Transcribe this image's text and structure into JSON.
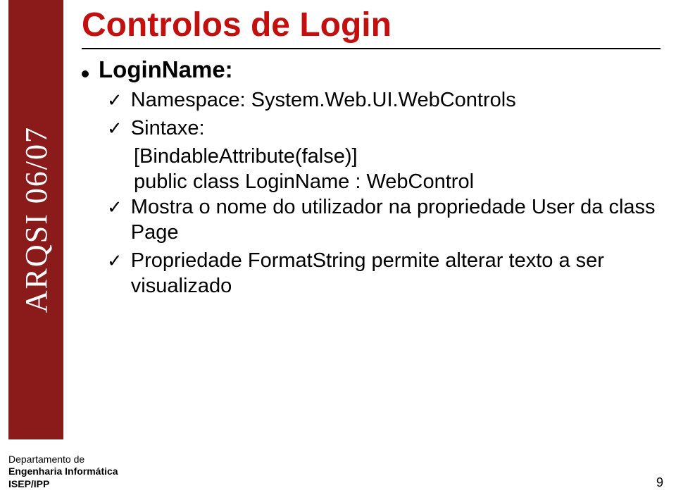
{
  "sidebar": {
    "label": "ARQSI 06/07"
  },
  "slide": {
    "title": "Controlos de Login"
  },
  "content": {
    "section": {
      "heading": "LoginName:",
      "items": [
        {
          "text": "Namespace: System.Web.UI.WebControls"
        },
        {
          "text": "Sintaxe:",
          "extra1": "[BindableAttribute(false)]",
          "extra2": "public class LoginName : WebControl"
        },
        {
          "text": "Mostra o nome do utilizador na propriedade User da class Page"
        },
        {
          "text": "Propriedade FormatString permite alterar texto a ser visualizado"
        }
      ]
    }
  },
  "footer": {
    "line1": "Departamento de",
    "line2": "Engenharia Informática",
    "line3": "ISEP/IPP"
  },
  "page": {
    "number": "9"
  }
}
